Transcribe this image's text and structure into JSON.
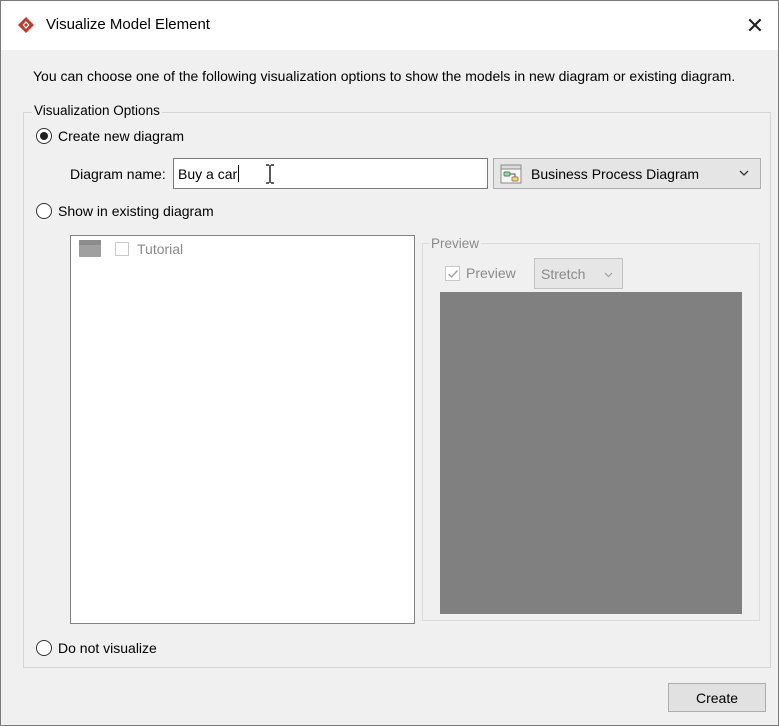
{
  "window": {
    "title": "Visualize Model Element",
    "close_symbol": "✕"
  },
  "intro_text": "You can choose one of the following visualization options to show the models in new diagram or existing diagram.",
  "options_group": {
    "legend": "Visualization Options",
    "create_new": {
      "label": "Create new diagram",
      "selected": true
    },
    "diagram_name_label": "Diagram name:",
    "diagram_name_value": "Buy a car",
    "diagram_type": {
      "selected": "Business Process Diagram",
      "icon": "business-process-diagram-icon"
    },
    "show_existing": {
      "label": "Show in existing diagram",
      "selected": false
    },
    "tree": {
      "items": [
        {
          "label": "Tutorial",
          "icon": "project-folder-icon",
          "checked": false
        }
      ]
    },
    "preview": {
      "legend": "Preview",
      "checkbox_label": "Preview",
      "checked": true,
      "scale_mode": "Stretch"
    },
    "do_not_visualize": {
      "label": "Do not visualize",
      "selected": false
    }
  },
  "buttons": {
    "create": "Create"
  },
  "colors": {
    "accent": "#c0392b",
    "preview_canvas": "#808080",
    "disabled_text": "#8a8a8a"
  }
}
